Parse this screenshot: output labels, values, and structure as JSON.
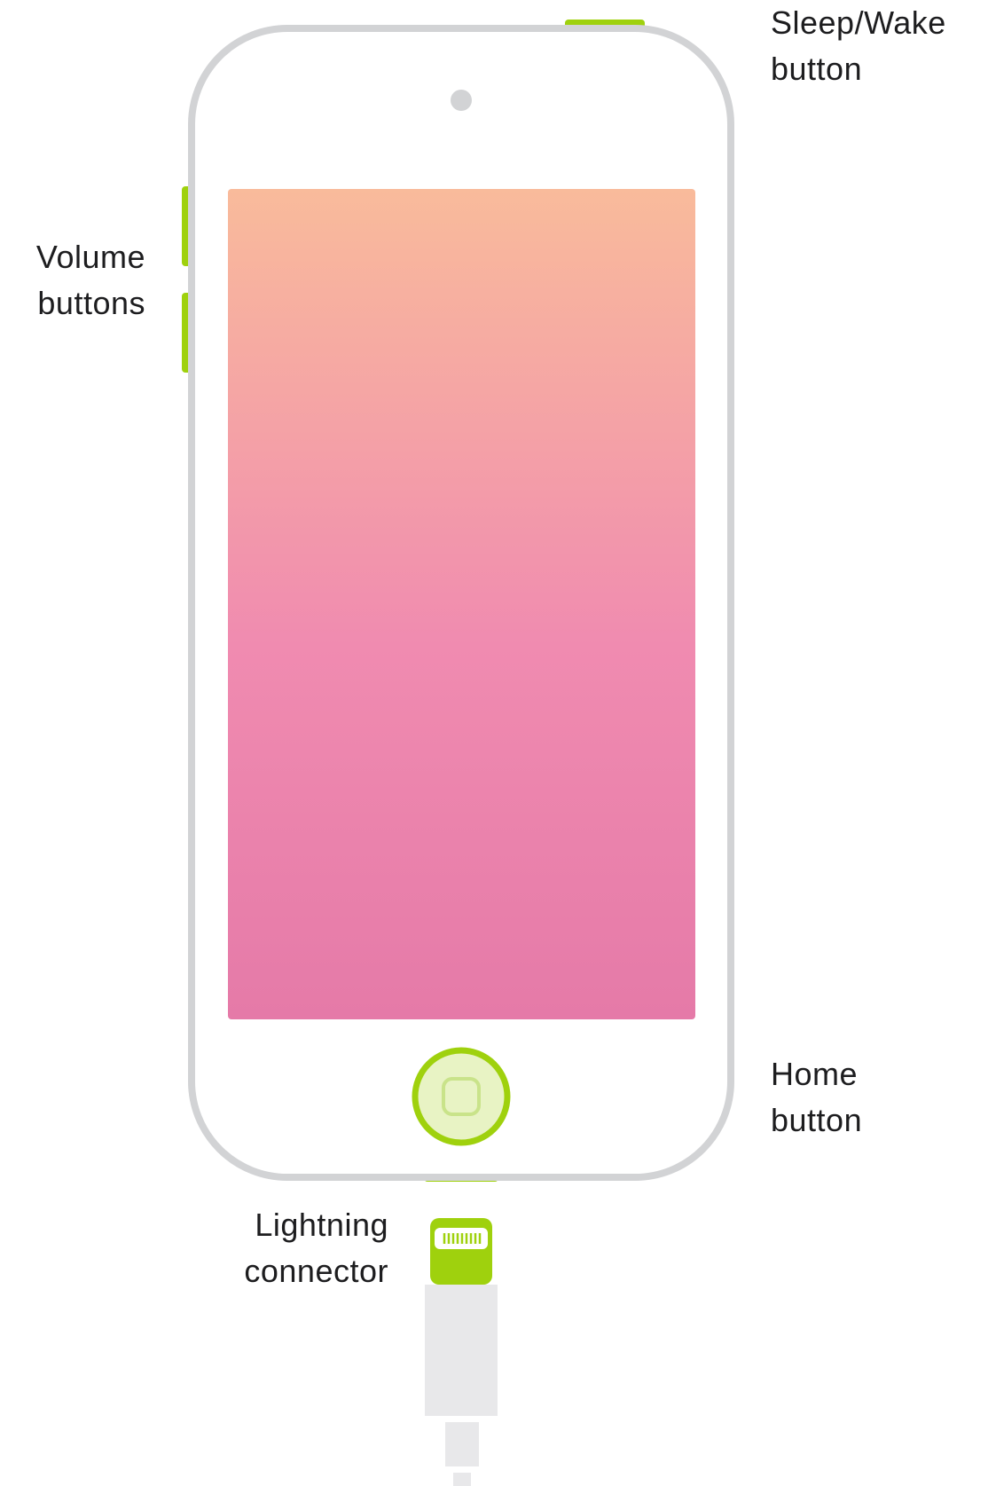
{
  "labels": {
    "sleep_wake": {
      "line1": "Sleep/Wake",
      "line2": "button"
    },
    "volume": {
      "line1": "Volume",
      "line2": "buttons"
    },
    "home": {
      "line1": "Home",
      "line2": "button"
    },
    "lightning": {
      "line1": "Lightning",
      "line2": "connector"
    }
  },
  "colors": {
    "accent_green": "#9fd10d",
    "device_outline": "#d2d3d5",
    "screen_top": "#f9bb9b",
    "screen_middle": "#f08bb0",
    "screen_bottom": "#e57aa8",
    "home_fill": "#e8f3c4",
    "cable_light": "#e8e8ea",
    "text": "#1d1d1f"
  },
  "icons": {
    "camera": "front-camera-dot",
    "home": "home-button-square",
    "connector": "lightning-plug"
  }
}
